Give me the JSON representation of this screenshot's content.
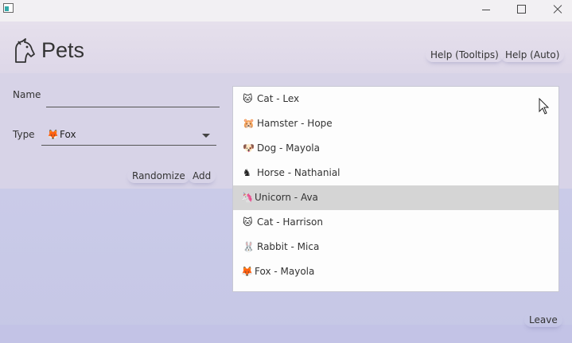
{
  "window": {
    "minimize_icon": "minimize-icon",
    "maximize_icon": "maximize-icon",
    "close_icon": "close-icon"
  },
  "header": {
    "logo_icon": "unicorn-icon",
    "title": "Pets",
    "help_tooltips_label": "Help (Tooltips)",
    "help_auto_label": "Help (Auto)"
  },
  "form": {
    "name_label": "Name",
    "name_value": "",
    "type_label": "Type",
    "type_icon": "🦊",
    "type_value": "Fox",
    "randomize_label": "Randomize",
    "add_label": "Add"
  },
  "pets": [
    {
      "icon": "🐱",
      "label": "Cat - Lex"
    },
    {
      "icon": "🐹",
      "label": "Hamster - Hope"
    },
    {
      "icon": "🐶",
      "label": "Dog - Mayola"
    },
    {
      "icon": "♞",
      "label": "Horse - Nathanial"
    },
    {
      "icon": "🦄",
      "label": "Unicorn - Ava",
      "selected": true
    },
    {
      "icon": "🐱",
      "label": "Cat - Harrison"
    },
    {
      "icon": "🐰",
      "label": "Rabbit - Mica"
    },
    {
      "icon": "🦊",
      "label": "Fox - Mayola"
    }
  ],
  "footer": {
    "leave_label": "Leave"
  },
  "colors": {
    "selected_row": "#d5d5d5",
    "background": "#c9c9e7",
    "header": "#e6e0ec"
  }
}
